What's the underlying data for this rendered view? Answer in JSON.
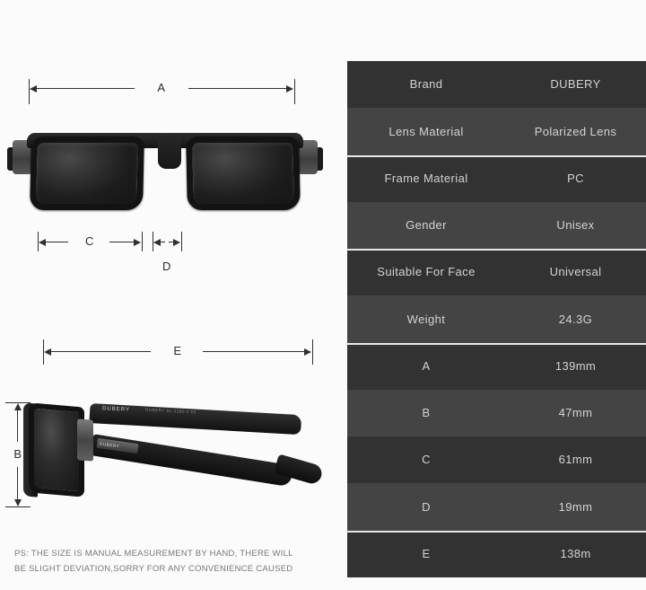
{
  "product": {
    "brand_mark": "DUBERY",
    "side_microtext": "DUBERY SL-2180-2 65"
  },
  "diagram": {
    "measure_a": "A",
    "measure_b": "B",
    "measure_c": "C",
    "measure_d": "D",
    "measure_e": "E"
  },
  "disclaimer": {
    "line1": "PS: THE SIZE IS MANUAL MEASUREMENT BY HAND, THERE WILL",
    "line2": "BE SLIGHT DEVIATION,SORRY FOR ANY CONVENIENCE CAUSED"
  },
  "spec_table": {
    "rows": [
      {
        "label": "Brand",
        "value": "DUBERY"
      },
      {
        "label": "Lens Material",
        "value": "Polarized Lens"
      },
      {
        "label": "Frame Material",
        "value": "PC"
      },
      {
        "label": "Gender",
        "value": "Unisex"
      },
      {
        "label": "Suitable For Face",
        "value": "Universal"
      },
      {
        "label": "Weight",
        "value": "24.3G"
      },
      {
        "label": "A",
        "value": "139mm"
      },
      {
        "label": "B",
        "value": "47mm"
      },
      {
        "label": "C",
        "value": "61mm"
      },
      {
        "label": "D",
        "value": "19mm"
      },
      {
        "label": "E",
        "value": "138m"
      }
    ]
  },
  "colors": {
    "page_background": "#fbfbfb",
    "row_dark": "#323232",
    "row_light": "#444444",
    "table_text": "#d3d3d3",
    "diagram_ink": "#2f2f2f",
    "disclaimer_text": "#777777"
  }
}
